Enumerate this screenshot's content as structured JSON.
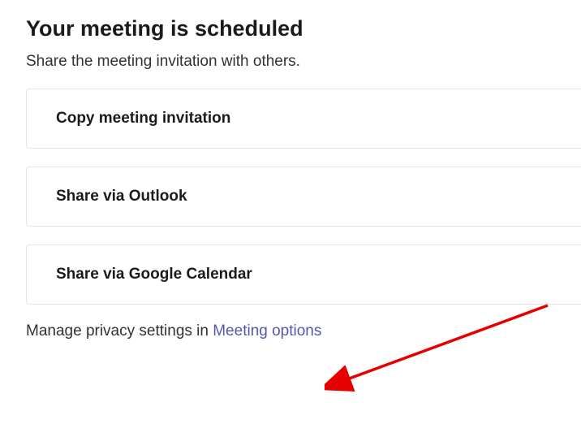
{
  "heading": "Your meeting is scheduled",
  "subheading": "Share the meeting invitation with others.",
  "options": [
    {
      "label": "Copy meeting invitation"
    },
    {
      "label": "Share via Outlook"
    },
    {
      "label": "Share via Google Calendar"
    }
  ],
  "footer": {
    "prefix": "Manage privacy settings in ",
    "link_text": "Meeting options"
  }
}
